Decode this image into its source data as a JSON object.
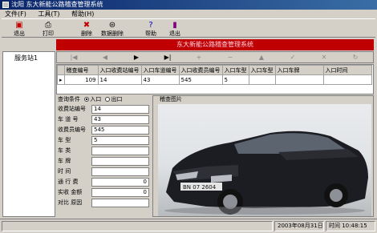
{
  "window": {
    "title": "沈阳 东大新能公路稽查管理系统"
  },
  "menu": [
    "文件(F)",
    "工具(T)",
    "帮助(H)"
  ],
  "toolbar": {
    "buttons": [
      {
        "label": "退出",
        "icon": "exit-icon"
      },
      {
        "label": "打印",
        "icon": "printer-icon"
      },
      {
        "label": "删除",
        "icon": "delete-icon"
      },
      {
        "label": "数据删除",
        "icon": "data-delete-icon"
      },
      {
        "label": "帮助",
        "icon": "help-icon"
      },
      {
        "label": "退出",
        "icon": "door-exit-icon"
      }
    ]
  },
  "banner": "东大新能公路稽查管理系统",
  "tree": {
    "node": "服务站1"
  },
  "navigator": [
    "|◀",
    "◀",
    "▶",
    "▶|",
    "+",
    "−",
    "▲",
    "✓",
    "✕",
    "↻"
  ],
  "grid": {
    "columns": [
      "稽查编号",
      "入口收费站编号",
      "入口车道编号",
      "入口收费员编号",
      "入口车型",
      "入口车型",
      "入口车牌",
      "入口时间"
    ],
    "rows": [
      [
        "109",
        "14",
        "43",
        "545",
        "5",
        "",
        "",
        ""
      ]
    ]
  },
  "form": {
    "query_label": "查询条件",
    "radio_entry": "入口",
    "radio_exit": "出口",
    "fields": [
      {
        "label": "收费站编号",
        "value": "14"
      },
      {
        "label": "车 道 号",
        "value": "43"
      },
      {
        "label": "收费员编号",
        "value": "545"
      },
      {
        "label": "车 型",
        "value": "5"
      },
      {
        "label": "车 类",
        "value": ""
      },
      {
        "label": "车 牌",
        "value": ""
      },
      {
        "label": "时 间",
        "value": ""
      },
      {
        "label": "通 行 费",
        "value": "0"
      },
      {
        "label": "实收 金额",
        "value": "0"
      },
      {
        "label": "对比 原因",
        "value": ""
      }
    ]
  },
  "photo": {
    "caption": "稽查图片",
    "plate": "BN 07 2604"
  },
  "status": {
    "date": "2003年08月31日",
    "time": "时间 10:48:15"
  },
  "colors": {
    "banner": "#c00000",
    "titlebar": "#0a246a"
  }
}
